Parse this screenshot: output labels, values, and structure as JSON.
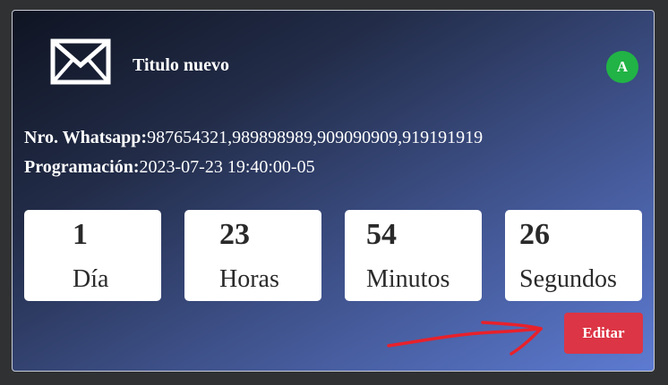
{
  "card": {
    "title": "Titulo nuevo",
    "avatar_letter": "A",
    "avatar_color": "#21b345",
    "icon": "envelope-icon"
  },
  "info": {
    "whatsapp_label": "Nro. Whatsapp:",
    "whatsapp_value": "987654321,989898989,909090909,919191919",
    "programacion_label": "Programación:",
    "programacion_value": "2023-07-23 19:40:00-05"
  },
  "countdown": [
    {
      "value": "1",
      "unit": "Día"
    },
    {
      "value": "23",
      "unit": "Horas"
    },
    {
      "value": "54",
      "unit": "Minutos"
    },
    {
      "value": "26",
      "unit": "Segundos"
    }
  ],
  "actions": {
    "edit_label": "Editar",
    "edit_color": "#dc3545"
  },
  "annotation": {
    "arrow_color": "#e8212b"
  }
}
